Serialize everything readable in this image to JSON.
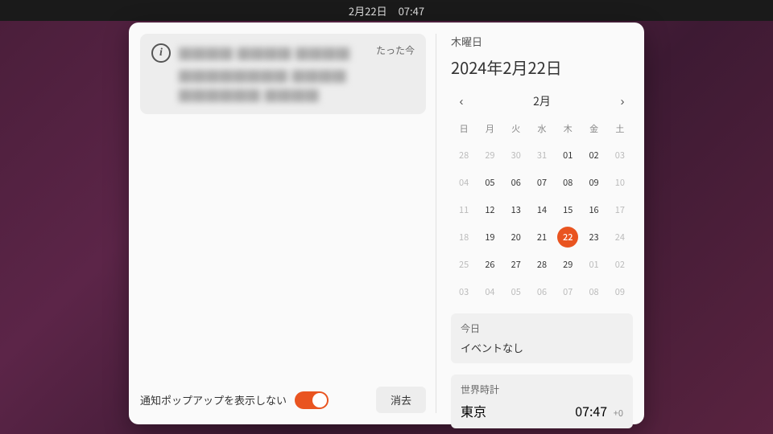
{
  "topbar": {
    "date": "2月22日",
    "time": "07:47"
  },
  "notifications": {
    "items": [
      {
        "title_placeholder": "████ ████ ████",
        "body_placeholder": "████████ ████ ██████ ████",
        "time": "たった今"
      }
    ],
    "dnd_label": "通知ポップアップを表示しない",
    "dnd_on": true,
    "clear_label": "消去"
  },
  "calendar": {
    "day_name": "木曜日",
    "full_date": "2024年2月22日",
    "month_label": "2月",
    "dow": [
      "日",
      "月",
      "火",
      "水",
      "木",
      "金",
      "土"
    ],
    "weeks": [
      [
        {
          "d": "28",
          "out": true
        },
        {
          "d": "29",
          "out": true
        },
        {
          "d": "30",
          "out": true
        },
        {
          "d": "31",
          "out": true
        },
        {
          "d": "01"
        },
        {
          "d": "02"
        },
        {
          "d": "03",
          "out": true
        }
      ],
      [
        {
          "d": "04",
          "out": true
        },
        {
          "d": "05"
        },
        {
          "d": "06"
        },
        {
          "d": "07"
        },
        {
          "d": "08"
        },
        {
          "d": "09"
        },
        {
          "d": "10",
          "out": true
        }
      ],
      [
        {
          "d": "11",
          "out": true
        },
        {
          "d": "12"
        },
        {
          "d": "13"
        },
        {
          "d": "14"
        },
        {
          "d": "15"
        },
        {
          "d": "16"
        },
        {
          "d": "17",
          "out": true
        }
      ],
      [
        {
          "d": "18",
          "out": true
        },
        {
          "d": "19"
        },
        {
          "d": "20"
        },
        {
          "d": "21"
        },
        {
          "d": "22",
          "today": true
        },
        {
          "d": "23"
        },
        {
          "d": "24",
          "out": true
        }
      ],
      [
        {
          "d": "25",
          "out": true
        },
        {
          "d": "26"
        },
        {
          "d": "27"
        },
        {
          "d": "28"
        },
        {
          "d": "29"
        },
        {
          "d": "01",
          "out": true
        },
        {
          "d": "02",
          "out": true
        }
      ],
      [
        {
          "d": "03",
          "out": true
        },
        {
          "d": "04",
          "out": true
        },
        {
          "d": "05",
          "out": true
        },
        {
          "d": "06",
          "out": true
        },
        {
          "d": "07",
          "out": true
        },
        {
          "d": "08",
          "out": true
        },
        {
          "d": "09",
          "out": true
        }
      ]
    ],
    "today_section": {
      "title": "今日",
      "body": "イベントなし"
    },
    "world_clock": {
      "title": "世界時計",
      "city": "東京",
      "time": "07:47",
      "offset": "+0"
    }
  },
  "colors": {
    "accent": "#e95420"
  }
}
